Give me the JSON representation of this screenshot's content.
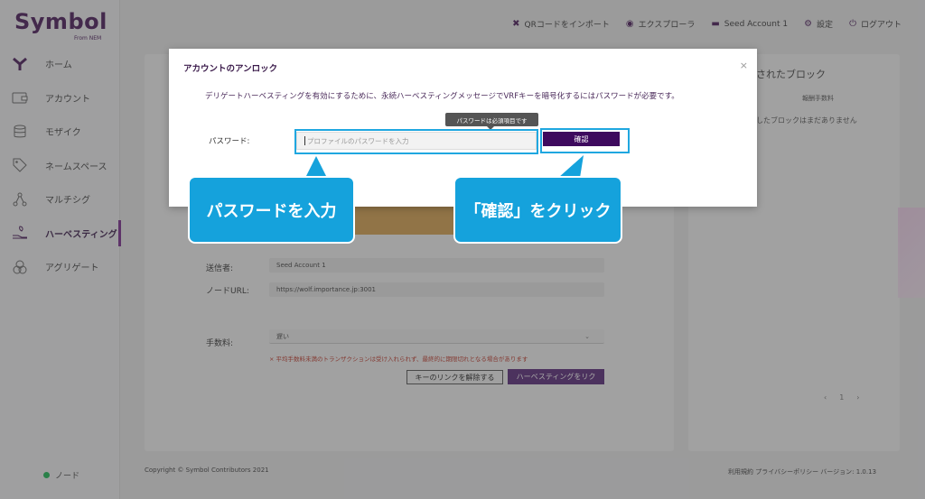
{
  "brand": {
    "logo_text": "Symbol",
    "logo_sub": "From NEM"
  },
  "topnav": {
    "items": [
      {
        "icon": "qr-icon",
        "label": "QRコードをインポート"
      },
      {
        "icon": "explorer-icon",
        "label": "エクスプローラ"
      },
      {
        "icon": "wallet-icon",
        "label": "Seed Account 1"
      },
      {
        "icon": "gear-icon",
        "label": "設定"
      },
      {
        "icon": "logout-icon",
        "label": "ログアウト"
      }
    ]
  },
  "sidebar": {
    "items": [
      {
        "label": "ホーム",
        "icon": "symbol-y-icon",
        "active": false
      },
      {
        "label": "アカウント",
        "icon": "account-icon",
        "active": false
      },
      {
        "label": "モザイク",
        "icon": "mosaic-icon",
        "active": false
      },
      {
        "label": "ネームスペース",
        "icon": "tag-icon",
        "active": false
      },
      {
        "label": "マルチシグ",
        "icon": "multisig-icon",
        "active": false
      },
      {
        "label": "ハーベスティング",
        "icon": "harvest-icon",
        "active": true
      },
      {
        "label": "アグリゲート",
        "icon": "aggregate-icon",
        "active": false
      }
    ],
    "node_status": "ノード"
  },
  "main": {
    "sender_label": "送信者:",
    "sender_value": "Seed Account 1",
    "node_url_label": "ノードURL:",
    "node_url_value": "https://wolf.importance.jp:3001",
    "fee_label": "手数料:",
    "fee_value": "遅い",
    "fee_warning": "平均手数料未満のトランザクションは受け入れられず、最終的に期限切れとなる場合があります",
    "unlink_button": "キーのリンクを解除する",
    "harvest_link_button": "ハーベスティングをリク"
  },
  "right_panel": {
    "title": "されたブロック",
    "column": "報酬手数料",
    "empty": "したブロックはまだありません",
    "pager_prev": "‹",
    "pager_page": "1",
    "pager_next": "›"
  },
  "footer": {
    "copyright": "Copyright © Symbol Contributors 2021",
    "links": "利用規約  プライバシーポリシー  バージョン: 1.0.13"
  },
  "modal": {
    "title": "アカウントのアンロック",
    "message": "デリゲートハーベスティングを有効にするために、永続ハーベスティングメッセージでVRFキーを暗号化するにはパスワードが必要です。",
    "password_label": "パスワード:",
    "password_placeholder": "プロファイルのパスワードを入力",
    "tooltip": "パスワードは必須項目です",
    "confirm_button": "確認",
    "close": "×"
  },
  "annotations": {
    "callout_password": "パスワードを入力",
    "callout_confirm": "「確認」をクリック",
    "highlight_color": "#1fa7e0",
    "callout_color": "#15a2dc"
  }
}
